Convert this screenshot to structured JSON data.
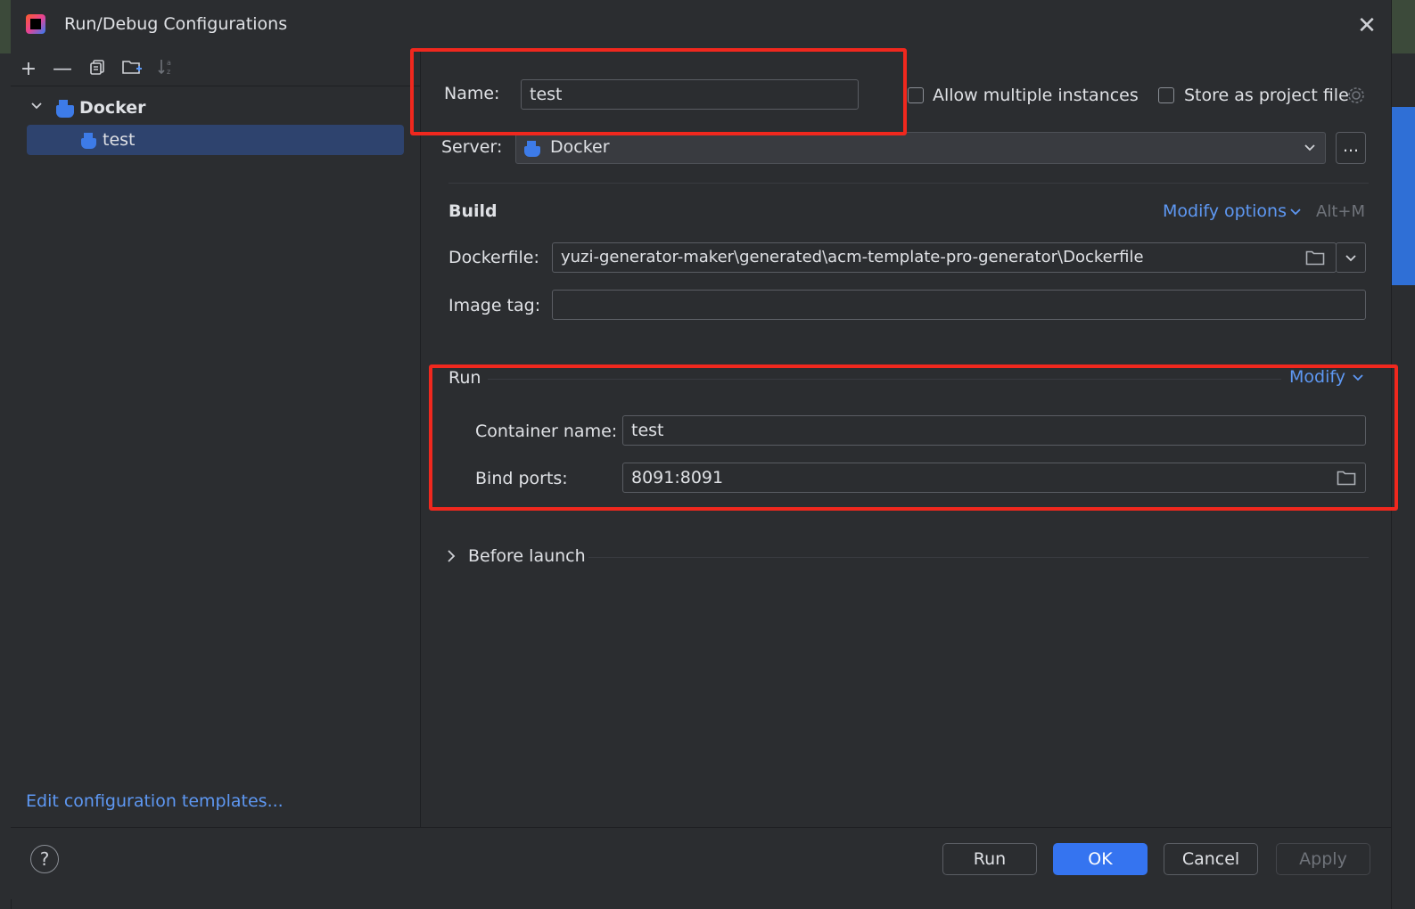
{
  "window": {
    "title": "Run/Debug Configurations"
  },
  "toolbar": {
    "icons": [
      "add-icon",
      "remove-icon",
      "copy-icon",
      "new-folder-icon",
      "sort-icon"
    ],
    "sort_glyph": "↓a\nz"
  },
  "tree": {
    "group_label": "Docker",
    "items": [
      {
        "label": "test"
      }
    ]
  },
  "left_footer": {
    "link": "Edit configuration templates..."
  },
  "form": {
    "name_label": "Name:",
    "name_value": "test",
    "allow_multiple_label": "Allow multiple instances",
    "store_project_label": "Store as project file",
    "server_label": "Server:",
    "server_value": "Docker",
    "more_label": "...",
    "build_title": "Build",
    "modify_options_label": "Modify options",
    "modify_options_shortcut": "Alt+M",
    "dockerfile_label": "Dockerfile:",
    "dockerfile_value": "yuzi-generator-maker\\generated\\acm-template-pro-generator\\Dockerfile",
    "image_tag_label": "Image tag:",
    "image_tag_value": "",
    "run_title": "Run",
    "modify_label": "Modify",
    "container_name_label": "Container name:",
    "container_name_value": "test",
    "bind_ports_label": "Bind ports:",
    "bind_ports_value": "8091:8091",
    "before_launch_label": "Before launch"
  },
  "footer": {
    "help": "?",
    "run": "Run",
    "ok": "OK",
    "cancel": "Cancel",
    "apply": "Apply"
  },
  "colors": {
    "accent": "#3574f0",
    "link": "#5e98f3",
    "highlight": "#f0281e",
    "selection": "#2e436e"
  }
}
